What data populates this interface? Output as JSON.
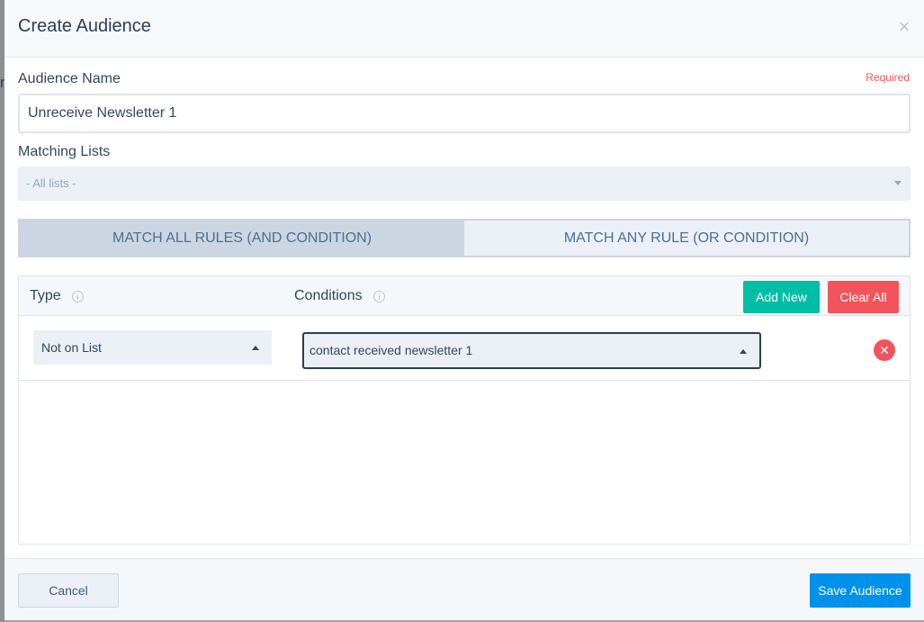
{
  "backdrop": {
    "glyph": "n"
  },
  "modal": {
    "title": "Create Audience",
    "close_icon": "×"
  },
  "audience_name": {
    "label": "Audience Name",
    "required_text": "Required",
    "value": "Unreceive Newsletter 1"
  },
  "matching_lists": {
    "label": "Matching Lists",
    "selected": "- All lists -"
  },
  "match_tabs": [
    {
      "label": "MATCH ALL RULES (AND CONDITION)",
      "active": true
    },
    {
      "label": "MATCH ANY RULE (OR CONDITION)",
      "active": false
    }
  ],
  "rules": {
    "type_header": "Type",
    "conditions_header": "Conditions",
    "add_new_label": "Add New",
    "clear_all_label": "Clear All",
    "rows": [
      {
        "type": "Not on List",
        "condition": "contact received newsletter 1"
      }
    ]
  },
  "footer": {
    "cancel_label": "Cancel",
    "save_label": "Save Audience"
  },
  "colors": {
    "teal": "#00bda5",
    "red": "#f2545b",
    "blue": "#0091ea",
    "text": "#33475b"
  }
}
